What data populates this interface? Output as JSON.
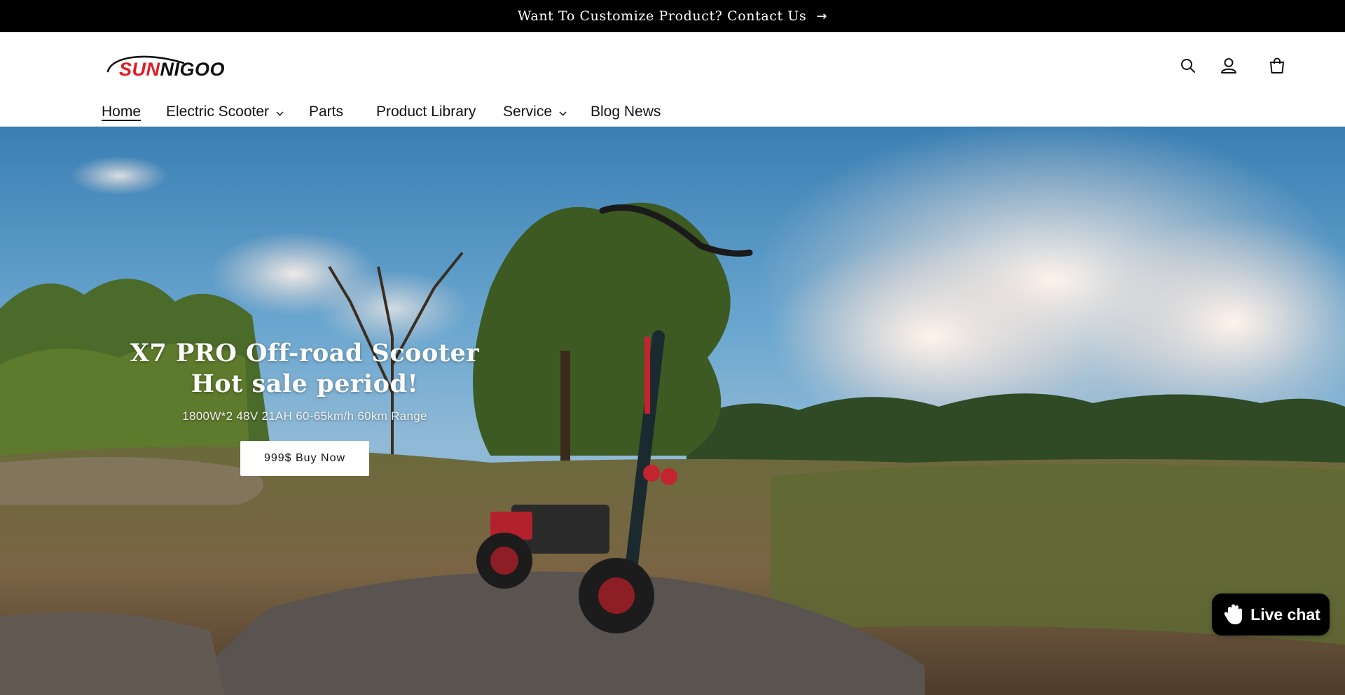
{
  "announcement": {
    "text": "Want To Customize Product? Contact Us",
    "arrow": "→"
  },
  "brand": {
    "logo_red": "SUN",
    "logo_black": "NIGOO",
    "red_color": "#e31b23"
  },
  "header_icons": {
    "search": "search-icon",
    "account": "account-icon",
    "cart": "cart-icon"
  },
  "nav": {
    "items": [
      {
        "label": "Home",
        "active": true,
        "dropdown": false
      },
      {
        "label": "Electric Scooter",
        "active": false,
        "dropdown": true
      },
      {
        "label": "Parts",
        "active": false,
        "dropdown": false
      },
      {
        "label": "Product Library",
        "active": false,
        "dropdown": false
      },
      {
        "label": "Service",
        "active": false,
        "dropdown": true
      },
      {
        "label": "Blog News",
        "active": false,
        "dropdown": false
      }
    ]
  },
  "hero": {
    "title": "X7 PRO Off-road Scooter Hot sale period!",
    "subtitle": "1800W*2 48V 21AH 60-65km/h 60km Range",
    "button": "999$ Buy Now"
  },
  "livechat": {
    "label": "Live chat",
    "icon": "waving-hand-icon"
  }
}
